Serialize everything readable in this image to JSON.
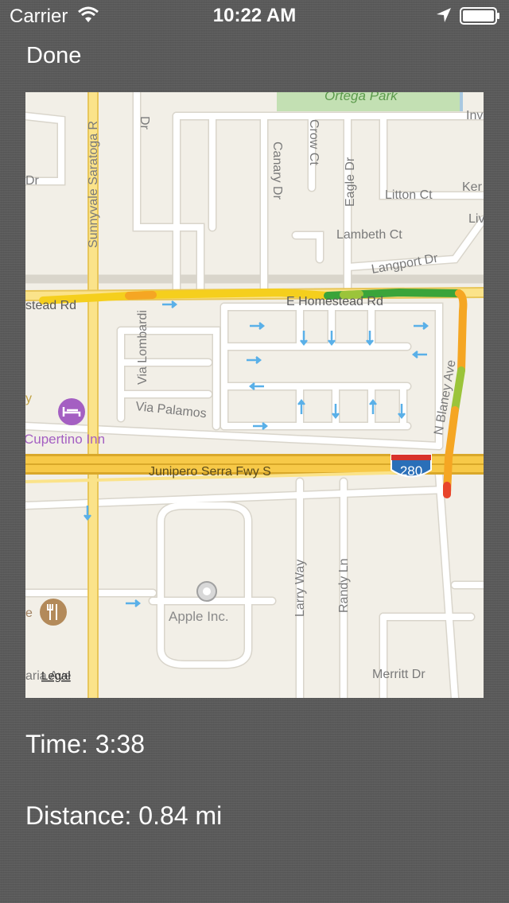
{
  "status_bar": {
    "carrier": "Carrier",
    "time": "10:22 AM",
    "icons": [
      "wifi-icon",
      "location-arrow-icon",
      "battery-icon"
    ]
  },
  "nav": {
    "done_label": "Done"
  },
  "map": {
    "labels": {
      "ortega_park": "Ortega Park",
      "inv": "Inv",
      "sunnyvale_saratoga": "Sunnyvale Saratoga R",
      "dr_top": "Dr",
      "dr_left": "Dr",
      "canary_dr": "Canary Dr",
      "crow_ct": "Crow Ct",
      "eagle_dr": "Eagle Dr",
      "litton_ct": "Litton Ct",
      "ker": "Ker",
      "liv": "Liv",
      "lambeth_ct": "Lambeth Ct",
      "langport_dr": "Langport Dr",
      "stead_rd": "stead Rd",
      "e_homestead_rd": "E Homestead Rd",
      "via_lombardi": "Via Lombardi",
      "via_palamos": "Via Palamos",
      "n_blaney_ave": "N Blaney Ave",
      "y_fragment": "y",
      "cupertino_inn": "Cupertino Inn",
      "junipero_serra": "Junipero Serra Fwy S",
      "shield_280": "280",
      "apple_inc": "Apple Inc.",
      "larry_way": "Larry Way",
      "randy_ln": "Randy Ln",
      "e_fragment": "e",
      "maria_ave": "aria Ave",
      "legal": "Legal",
      "merritt_dr": "Merritt Dr"
    },
    "route_colors": {
      "yellow": "#f5cf1d",
      "orange": "#f5a623",
      "green": "#3aa43a",
      "red": "#e8452c"
    },
    "icons": [
      "hotel-icon",
      "restaurant-icon",
      "apple-pin-icon",
      "one-way-arrow-icon"
    ]
  },
  "stats": {
    "time_text": "Time: 3:38",
    "distance_text": "Distance: 0.84 mi"
  }
}
